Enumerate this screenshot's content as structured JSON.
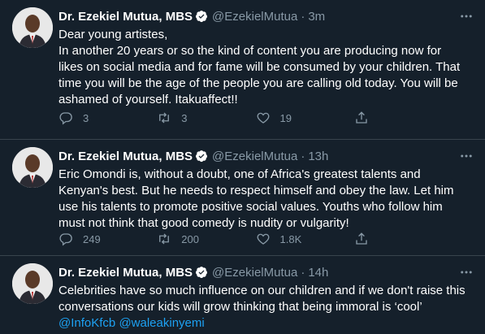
{
  "tweets": [
    {
      "author_name": "Dr. Ezekiel Mutua, MBS",
      "handle": "@EzekielMutua",
      "separator": "·",
      "time": "3m",
      "lines": [
        "Dear young artistes,",
        "In another 20 years or so the kind of content you are producing now for",
        "likes on social media and for fame will be consumed by your children. That",
        "time you will be the age of the people you are calling old today. You will be",
        "ashamed of yourself. Itakuaffect!!"
      ],
      "replies": "3",
      "retweets": "3",
      "likes": "19"
    },
    {
      "author_name": "Dr. Ezekiel Mutua, MBS",
      "handle": "@EzekielMutua",
      "separator": "·",
      "time": "13h",
      "lines": [
        "Eric Omondi is, without a doubt, one of Africa's greatest talents and",
        "Kenyan's best. But he needs to respect himself and obey the law. Let him",
        "use his talents to promote positive social values. Youths who follow him",
        "must not think that good comedy is nudity or vulgarity!"
      ],
      "replies": "249",
      "retweets": "200",
      "likes": "1.8K"
    },
    {
      "author_name": "Dr. Ezekiel Mutua, MBS",
      "handle": "@EzekielMutua",
      "separator": "·",
      "time": "14h",
      "lines": [
        "Celebrities have so much influence on our children and if we don't raise this",
        "conversations our kids will grow thinking that being immoral is ‘cool’"
      ],
      "mentions": [
        "@InfoKfcb",
        "@waleakinyemi"
      ],
      "replies": "",
      "retweets": "",
      "likes": ""
    }
  ],
  "colors": {
    "background": "#15202b",
    "divider": "#38444d",
    "muted": "#8899a6",
    "link": "#1da1f2",
    "verified": "#ffffff"
  },
  "icons": [
    "avatar",
    "verified-icon",
    "more-icon",
    "reply-icon",
    "retweet-icon",
    "like-icon",
    "share-icon"
  ]
}
